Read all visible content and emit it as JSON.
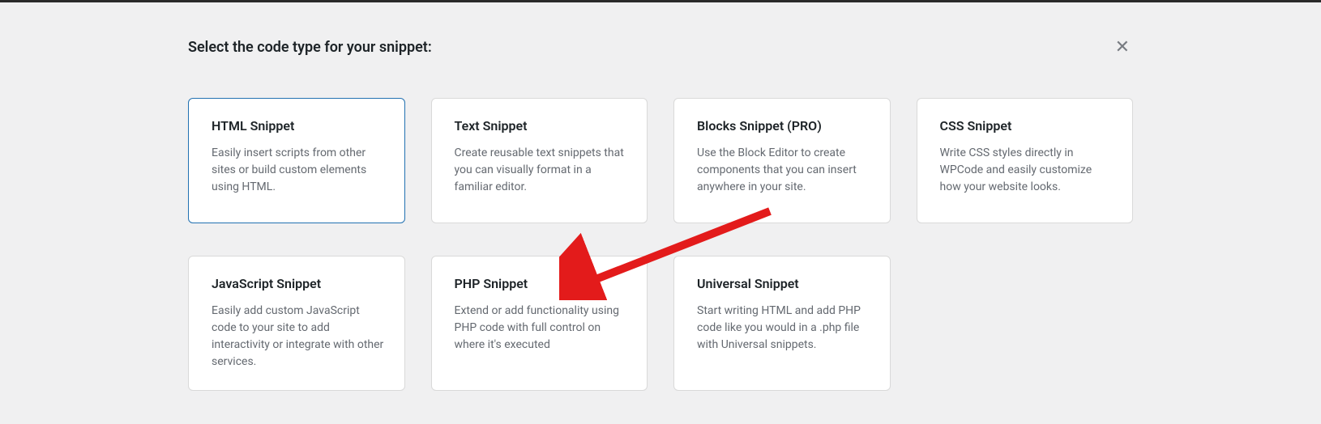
{
  "page_title": "Select the code type for your snippet:",
  "close_icon": "✕",
  "cards": [
    {
      "title": "HTML Snippet",
      "description": "Easily insert scripts from other sites or build custom elements using HTML.",
      "selected": true
    },
    {
      "title": "Text Snippet",
      "description": "Create reusable text snippets that you can visually format in a familiar editor.",
      "selected": false
    },
    {
      "title": "Blocks Snippet (PRO)",
      "description": "Use the Block Editor to create components that you can insert anywhere in your site.",
      "selected": false
    },
    {
      "title": "CSS Snippet",
      "description": "Write CSS styles directly in WPCode and easily customize how your website looks.",
      "selected": false
    },
    {
      "title": "JavaScript Snippet",
      "description": "Easily add custom JavaScript code to your site to add interactivity or integrate with other services.",
      "selected": false
    },
    {
      "title": "PHP Snippet",
      "description": "Extend or add functionality using PHP code with full control on where it's executed",
      "selected": false
    },
    {
      "title": "Universal Snippet",
      "description": "Start writing HTML and add PHP code like you would in a .php file with Universal snippets.",
      "selected": false
    }
  ]
}
